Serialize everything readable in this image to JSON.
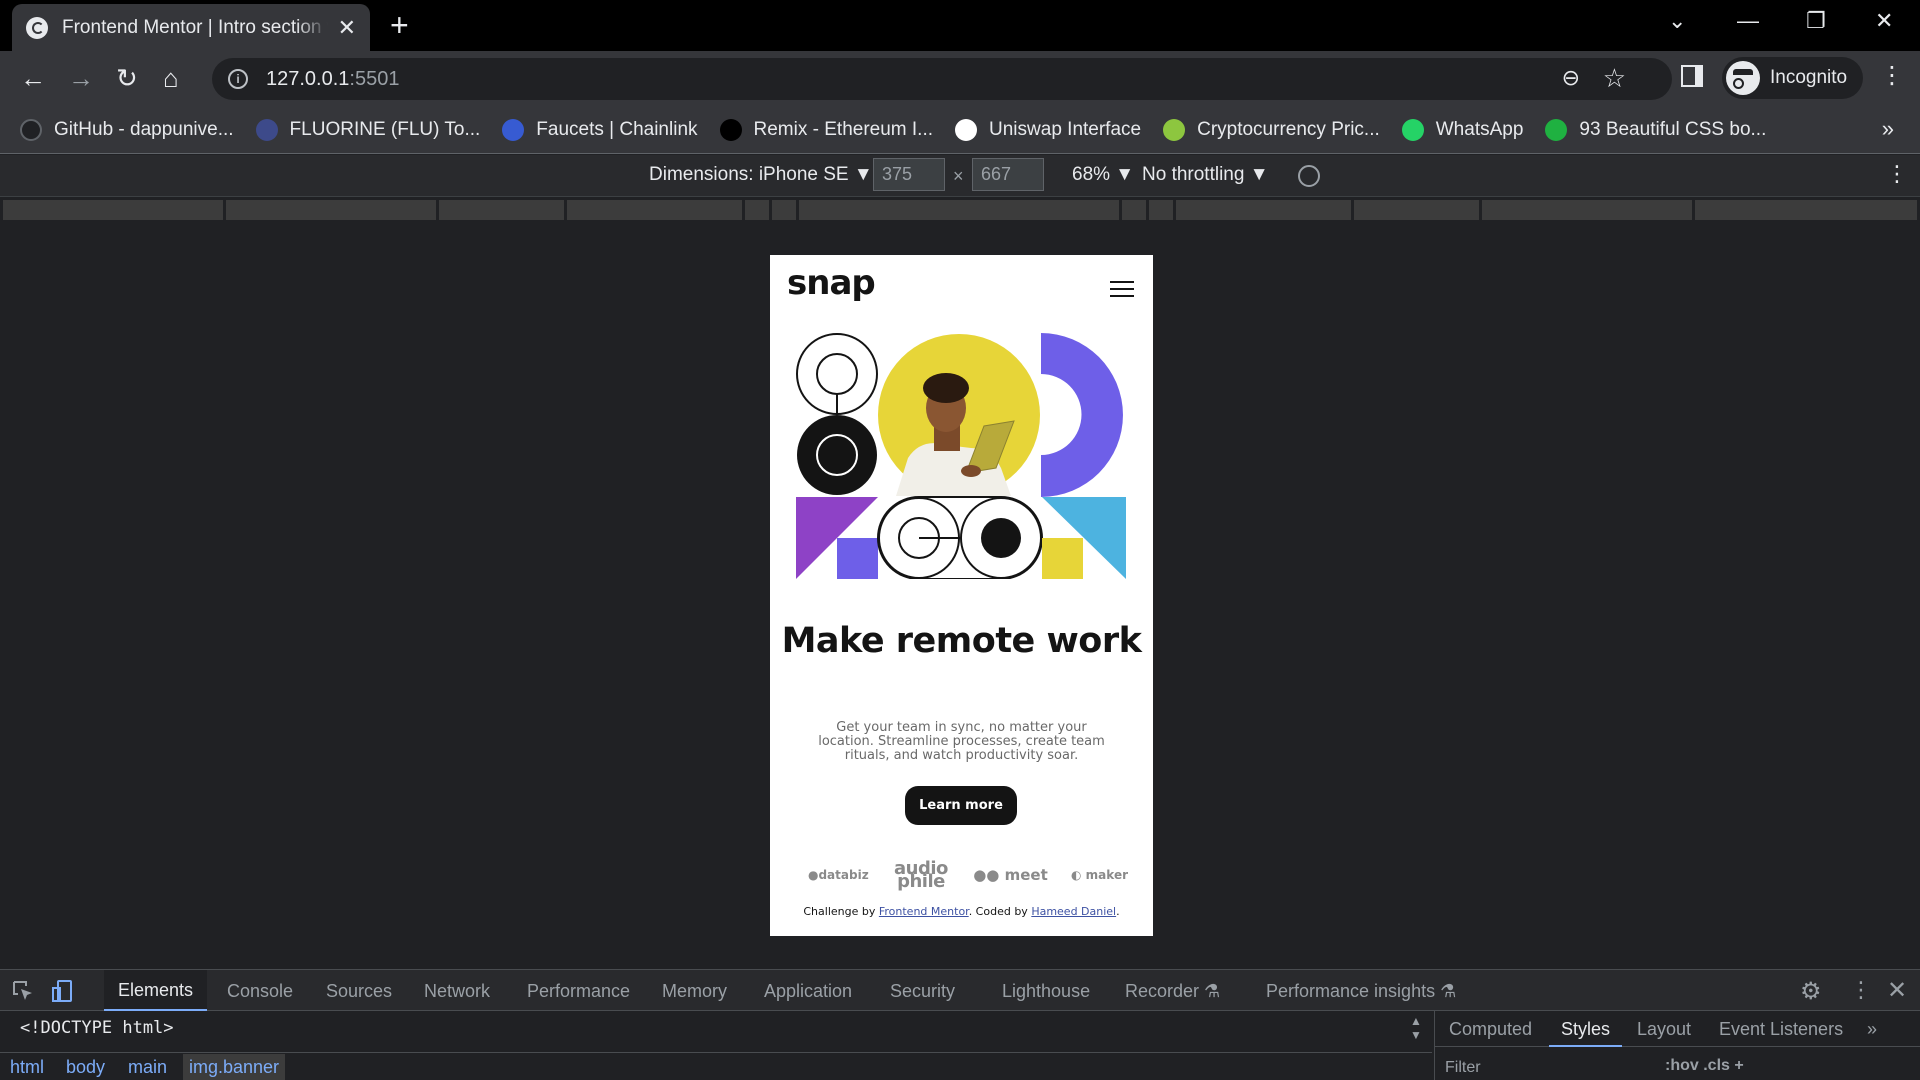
{
  "browser": {
    "tab_title": "Frontend Mentor | Intro section w",
    "tab_close": "✕",
    "new_tab": "+",
    "window_controls": {
      "dropdown": "⌄",
      "minimize": "—",
      "restore": "❐",
      "close": "✕"
    },
    "nav": {
      "back": "←",
      "forward": "→",
      "reload": "↻",
      "home": "⌂"
    },
    "url_host": "127.0.0.1",
    "url_port": ":5501",
    "profile_label": "Incognito",
    "menu": "⋮",
    "bookmarks": [
      {
        "label": "GitHub - dappunive...",
        "icon": "github-icon",
        "color": "#202124"
      },
      {
        "label": "FLUORINE (FLU) To...",
        "icon": "fluorine-icon",
        "color": "#3d4a8a"
      },
      {
        "label": "Faucets | Chainlink",
        "icon": "chainlink-icon",
        "color": "#375bd2"
      },
      {
        "label": "Remix - Ethereum I...",
        "icon": "remix-icon",
        "color": "#000000"
      },
      {
        "label": "Uniswap Interface",
        "icon": "uniswap-icon",
        "color": "#ffffff"
      },
      {
        "label": "Cryptocurrency Pric...",
        "icon": "coingecko-icon",
        "color": "#8dc63f"
      },
      {
        "label": "WhatsApp",
        "icon": "whatsapp-icon",
        "color": "#25d366"
      },
      {
        "label": "93 Beautiful CSS bo...",
        "icon": "css-icon",
        "color": "#1fb141"
      }
    ],
    "bookmarks_more": "»"
  },
  "device_toolbar": {
    "dimensions_label": "Dimensions: iPhone SE ▼",
    "width": "375",
    "height": "667",
    "times": "×",
    "zoom": "68% ▼",
    "throttle": "No throttling ▼",
    "more": "⋮"
  },
  "page": {
    "logo": "snap",
    "headline": "Make remote work",
    "description": "Get your team in sync, no matter your location. Streamline processes, create team rituals, and watch productivity soar.",
    "cta": "Learn more",
    "clients": {
      "databiz": "●databiz",
      "audiophile": "audio phile",
      "meet": "●● meet",
      "maker": "◐ maker"
    },
    "attribution": {
      "prefix": "Challenge by ",
      "fm": "Frontend Mentor",
      "middle": ". Coded by ",
      "author": "Hameed Daniel",
      "suffix": "."
    },
    "colors": {
      "yellow": "#e7d538",
      "purple": "#6e5fe8",
      "violet": "#8e42c6",
      "blue": "#4db3e0",
      "ink": "#141414"
    }
  },
  "devtools": {
    "tabs": [
      "Elements",
      "Console",
      "Sources",
      "Network",
      "Performance",
      "Memory",
      "Application",
      "Security",
      "Lighthouse",
      "Recorder ⚗",
      "Performance insights ⚗"
    ],
    "tab_more": "»",
    "settings": "⚙",
    "kebab": "⋮",
    "close": "✕",
    "dom_line": "<!DOCTYPE html>",
    "breadcrumbs": [
      "html",
      "body",
      "main",
      "img.banner"
    ],
    "side_tabs": [
      "Computed",
      "Styles",
      "Layout",
      "Event Listeners"
    ],
    "side_more": "»",
    "filter_placeholder": "Filter",
    "filter_tools": ":hov  .cls  +"
  }
}
